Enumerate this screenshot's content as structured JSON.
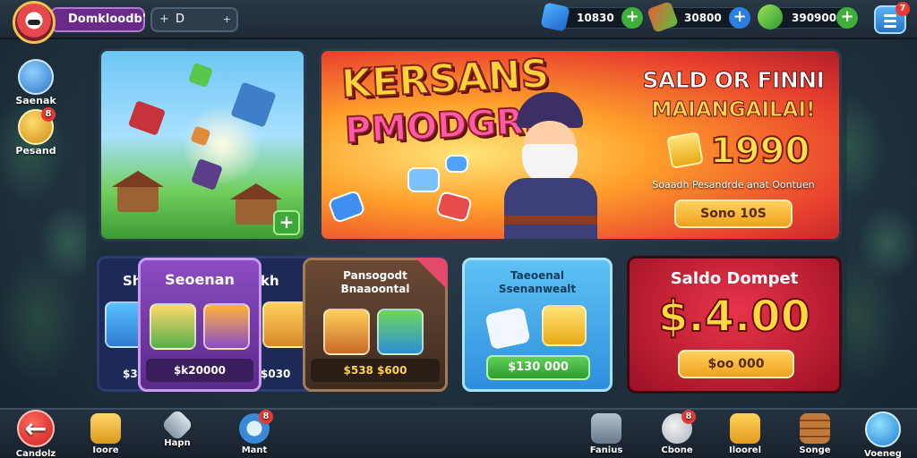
{
  "topbar": {
    "player_name": "Domkloodb'",
    "level_prefix": "+",
    "level_text": "D",
    "level_arrow": "+",
    "resources": [
      {
        "icon": "gem-blue-icon",
        "value": "10830",
        "plus": "+"
      },
      {
        "icon": "potion-icon",
        "value": "30800",
        "plus": "+"
      },
      {
        "icon": "leaf-gem-icon",
        "value": "390900",
        "plus": "+"
      }
    ],
    "menu_badge": "7"
  },
  "side": {
    "items": [
      {
        "label": "Saenak",
        "badge": ""
      },
      {
        "label": "Pesand",
        "badge": "8"
      }
    ]
  },
  "hero_left": {
    "plus": "+"
  },
  "promo": {
    "title1": "KERSANS",
    "title2": "PMODGRI",
    "heading": "SALD OR FINNI",
    "subheading": "MAIANGAILAI!",
    "amount": "1990",
    "small": "Soaadh Pesandrde anat Oontuen",
    "button": "Sono 10S"
  },
  "shelf": {
    "left_title": "Sh",
    "right_title": "kh",
    "left_price": "$3",
    "right_price": "$030"
  },
  "card_purple": {
    "title": "Seoenan",
    "price": "$k20000"
  },
  "card_brown": {
    "title1": "Pansogodt",
    "title2": "Bnaaoontal",
    "price": "$538 $600"
  },
  "card_blue": {
    "title1": "Taeoenal",
    "title2": "Ssenanwealt",
    "price": "$130 000"
  },
  "card_red": {
    "title": "Saldo Dompet",
    "amount": "$.4.00",
    "button": "$oo 000"
  },
  "bottom_nav": [
    {
      "label": "Candolz",
      "icon": "back-arrow-icon",
      "badge": ""
    },
    {
      "label": "Ioore",
      "icon": "chest-icon",
      "badge": ""
    },
    {
      "label": "Hapn",
      "icon": "sword-icon",
      "badge": ""
    },
    {
      "label": "Mant",
      "icon": "map-icon",
      "badge": "8"
    },
    {
      "label": "Fanius",
      "icon": "tools-icon",
      "badge": ""
    },
    {
      "label": "Cbone",
      "icon": "pig-icon",
      "badge": "8"
    },
    {
      "label": "Iloorel",
      "icon": "treasure-icon",
      "badge": ""
    },
    {
      "label": "Songe",
      "icon": "book-stack-icon",
      "badge": ""
    },
    {
      "label": "Voeneg",
      "icon": "globe-icon",
      "badge": ""
    }
  ],
  "colors": {
    "accent_gold": "#ffd23a",
    "purple": "#6b2a8a",
    "green": "#3fae3a",
    "blue": "#2b7fe0",
    "red": "#e53935"
  }
}
